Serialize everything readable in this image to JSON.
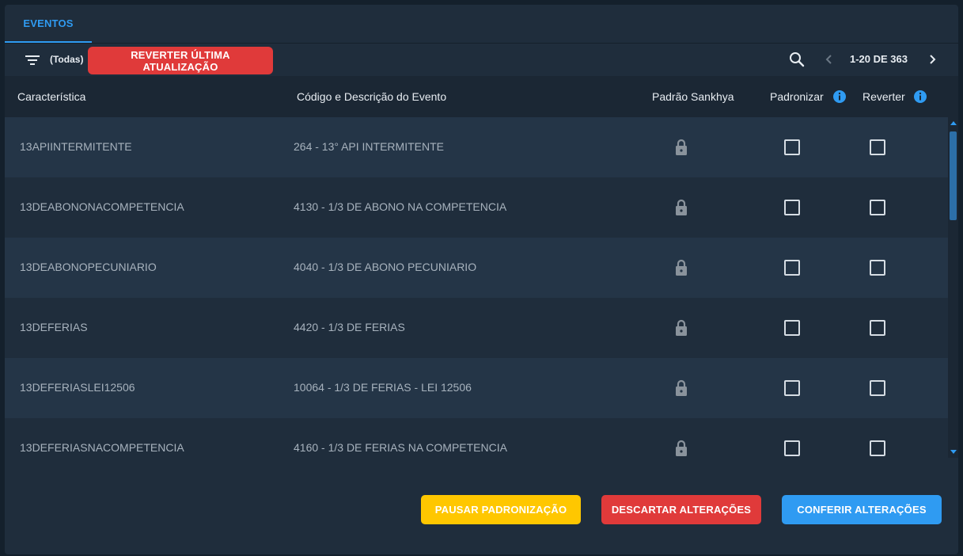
{
  "tabs": [
    {
      "label": "EVENTOS",
      "active": true
    }
  ],
  "toolbar": {
    "filter_label": "(Todas)",
    "revert_last_label": "REVERTER ÚLTIMA ATUALIZAÇÃO",
    "pager_text": "1-20 DE 363"
  },
  "columns": {
    "caracteristica": "Característica",
    "codigo": "Código e Descrição do Evento",
    "padrao": "Padrão Sankhya",
    "padronizar": "Padronizar",
    "reverter": "Reverter"
  },
  "rows": [
    {
      "caracteristica": "13APIINTERMITENTE",
      "evento": "264 - 13° API INTERMITENTE",
      "padronizar": false,
      "reverter": false
    },
    {
      "caracteristica": "13DEABONONACOMPETENCIA",
      "evento": "4130 - 1/3 DE ABONO NA COMPETENCIA",
      "padronizar": false,
      "reverter": false
    },
    {
      "caracteristica": "13DEABONOPECUNIARIO",
      "evento": "4040 - 1/3 DE ABONO PECUNIARIO",
      "padronizar": false,
      "reverter": false
    },
    {
      "caracteristica": "13DEFERIAS",
      "evento": "4420 - 1/3 DE FERIAS",
      "padronizar": false,
      "reverter": false
    },
    {
      "caracteristica": "13DEFERIASLEI12506",
      "evento": "10064 - 1/3 DE FERIAS - LEI 12506",
      "padronizar": false,
      "reverter": false
    },
    {
      "caracteristica": "13DEFERIASNACOMPETENCIA",
      "evento": "4160 - 1/3 DE FERIAS NA COMPETENCIA",
      "padronizar": false,
      "reverter": false
    }
  ],
  "footer": {
    "pause_label": "PAUSAR PADRONIZAÇÃO",
    "discard_label": "DESCARTAR ALTERAÇÕES",
    "confirm_label": "CONFERIR ALTERAÇÕES"
  },
  "icons": {
    "filter": "filter-icon",
    "search": "search-icon",
    "prev": "chevron-left-icon",
    "next": "chevron-right-icon",
    "info": "info-icon",
    "lock": "lock-icon"
  },
  "colors": {
    "accent": "#2f9bf2",
    "danger": "#e03a3a",
    "warning": "#ffc700",
    "panel": "#1f2d3c",
    "row_alt": "#243547"
  }
}
